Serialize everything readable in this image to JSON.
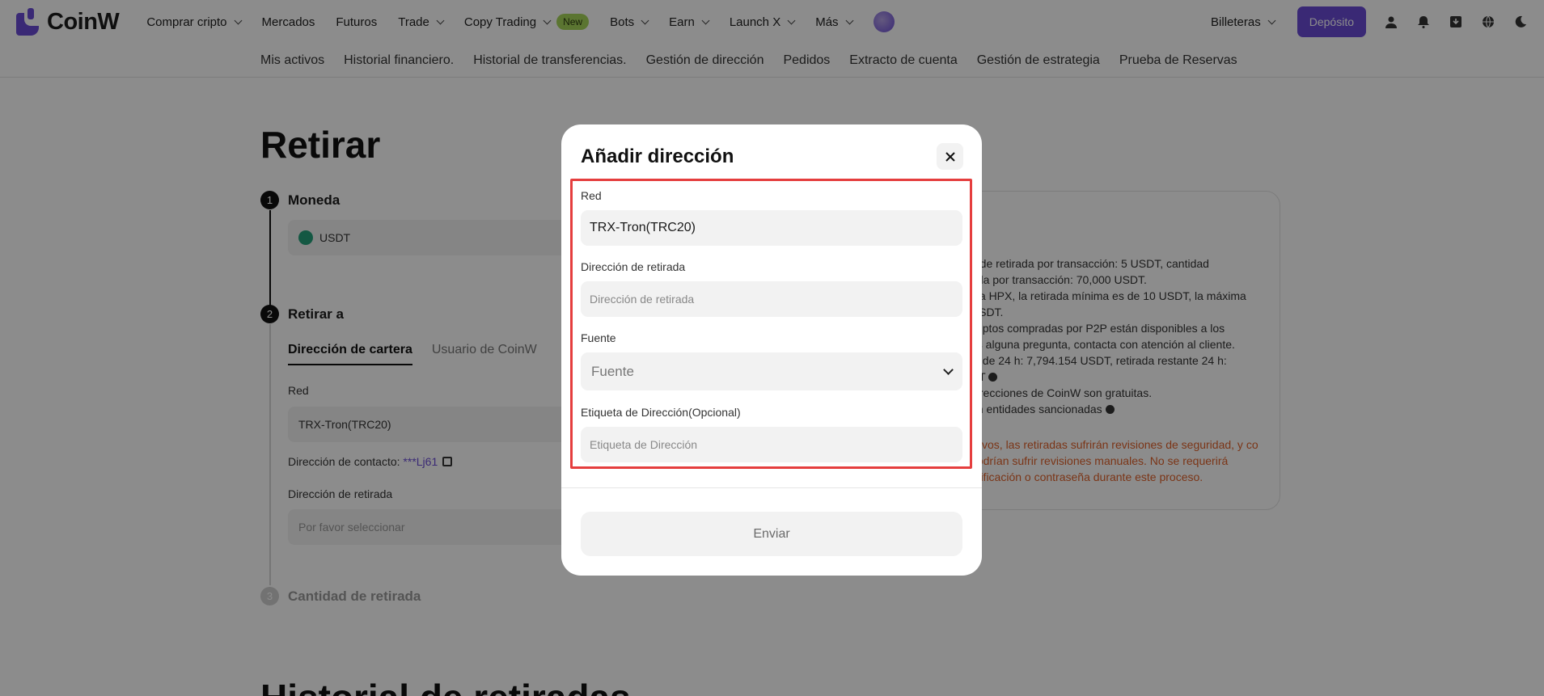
{
  "nav": {
    "brand": "CoinW",
    "items": [
      {
        "label": "Comprar cripto",
        "dropdown": true
      },
      {
        "label": "Mercados",
        "dropdown": false
      },
      {
        "label": "Futuros",
        "dropdown": false
      },
      {
        "label": "Trade",
        "dropdown": true
      },
      {
        "label": "Copy Trading",
        "dropdown": true
      },
      {
        "label": "Bots",
        "dropdown": true
      },
      {
        "label": "Earn",
        "dropdown": true
      },
      {
        "label": "Launch X",
        "dropdown": true
      },
      {
        "label": "Más",
        "dropdown": true
      }
    ],
    "new_badge": "New",
    "wallets": "Billeteras",
    "deposit": "Depósito",
    "accent": "#6a4cd6"
  },
  "subnav": [
    "Mis activos",
    "Historial financiero.",
    "Historial de transferencias.",
    "Gestión de dirección",
    "Pedidos",
    "Extracto de cuenta",
    "Gestión de estrategia",
    "Prueba de Reservas"
  ],
  "page": {
    "title": "Retirar",
    "step1": {
      "num": "1",
      "label": "Moneda",
      "coin": "USDT"
    },
    "step2": {
      "num": "2",
      "label": "Retirar a",
      "tabs": [
        "Dirección de cartera",
        "Usuario de CoinW"
      ],
      "red_label": "Red",
      "red_value": "TRX-Tron(TRC20)",
      "contact_label": "Dirección de contacto:",
      "contact_value": "***Lj61",
      "address_label": "Dirección de retirada",
      "address_placeholder": "Por favor seleccionar"
    },
    "step3": {
      "num": "3",
      "label": "Cantidad de retirada"
    },
    "history_title": "Historial de retiradas",
    "info_lines": [
      "a de retirada por transacción: 5 USDT, cantidad",
      "ada por transacción: 70,000 USDT.",
      "s a HPX, la retirada mínima es de 10 USDT, la máxima",
      "USDT.",
      "criptos compradas por P2P están disponibles a los",
      "es alguna pregunta, contacta con atención al cliente.",
      "la de 24 h: 7,794.154 USDT, retirada restante 24 h:",
      "DT",
      "direcciones de CoinW son gratuitas.",
      "on entidades sancionadas"
    ],
    "info_warning": "ctivos, las retiradas sufrirán revisiones de seguridad, y co podrían sufrir revisiones manuales. No se requerirá erificación o contraseña durante este proceso."
  },
  "modal": {
    "title": "Añadir dirección",
    "red_label": "Red",
    "red_value": "TRX-Tron(TRC20)",
    "address_label": "Dirección de retirada",
    "address_placeholder": "Dirección de retirada",
    "source_label": "Fuente",
    "source_placeholder": "Fuente",
    "tag_label": "Etiqueta de Dirección(Opcional)",
    "tag_placeholder": "Etiqueta de Dirección",
    "submit": "Enviar",
    "highlight_color": "#e53e3e"
  }
}
